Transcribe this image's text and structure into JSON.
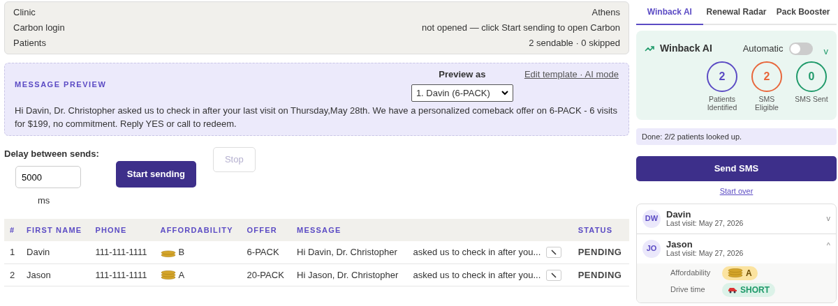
{
  "info_rows": [
    {
      "label": "Clinic",
      "value": "Athens"
    },
    {
      "label": "Carbon login",
      "value": "not opened — click Start sending to open Carbon"
    },
    {
      "label": "Patients",
      "value": "2 sendable · 0 skipped"
    }
  ],
  "preview": {
    "heading": "MESSAGE PREVIEW",
    "preview_as_label": "Preview as",
    "select_value": "1. Davin (6-PACK)",
    "edit_link": "Edit template · AI mode",
    "text": "Hi Davin, Dr. Christopher asked us to check in after your last visit on Thursday,May 28th. We have a personalized comeback offer on 6-PACK - 6 visits for $199, no commitment. Reply YES or call to redeem."
  },
  "delay": {
    "label": "Delay between sends:",
    "value": "5000",
    "unit": "ms"
  },
  "start_button": {
    "label": "Start sending",
    "disabled": false
  },
  "stop_button": {
    "label": "Stop",
    "disabled": true
  },
  "table": {
    "columns": [
      "#",
      "FIRST NAME",
      "PHONE",
      "AFFORDABILITY",
      "OFFER",
      "MESSAGE",
      "STATUS"
    ],
    "rows": [
      {
        "num": "1",
        "first_name": "Davin",
        "phone": "111-111-1111",
        "tier": "B",
        "offer": "6-PACK",
        "message_start": "Hi Davin, Dr. Christopher",
        "message_end": "asked us to check in after you...",
        "status": "PENDING"
      },
      {
        "num": "2",
        "first_name": "Jason",
        "phone": "111-111-1111",
        "tier": "A",
        "offer": "20-PACK",
        "message_start": "Hi Jason, Dr. Christopher",
        "message_end": "asked us to check in after you...",
        "status": "PENDING"
      }
    ]
  },
  "tabs": [
    {
      "label": "Winback AI",
      "selected": true
    },
    {
      "label": "Renewal Radar",
      "selected": false
    },
    {
      "label": "Pack Booster",
      "selected": false
    }
  ],
  "summary": {
    "title": "Winback AI",
    "automatic_label": "Automatic",
    "automatic_on": false,
    "collapse_glyph": "v",
    "stats": [
      {
        "value": "2",
        "label": "Patients Identified",
        "color": "#5b4bc4"
      },
      {
        "value": "2",
        "label": "SMS Eligible",
        "color": "#e8673c"
      },
      {
        "value": "0",
        "label": "SMS Sent",
        "color": "#1f9a6a"
      }
    ]
  },
  "status_note": "Done: 2/2 patients looked up.",
  "send_button": "Send SMS",
  "start_over": "Start over",
  "patients": [
    {
      "initials": "DW",
      "name": "Davin",
      "last_visit": "Last visit: May 27, 2026",
      "expanded": false,
      "toggle_glyph": "v"
    },
    {
      "initials": "JO",
      "name": "Jason",
      "last_visit": "Last visit: May 27, 2026",
      "expanded": true,
      "toggle_glyph": "^",
      "details": [
        {
          "label": "Affordability",
          "kind": "coins",
          "value": "A"
        },
        {
          "label": "Drive time",
          "kind": "car",
          "value": "SHORT"
        }
      ]
    }
  ]
}
